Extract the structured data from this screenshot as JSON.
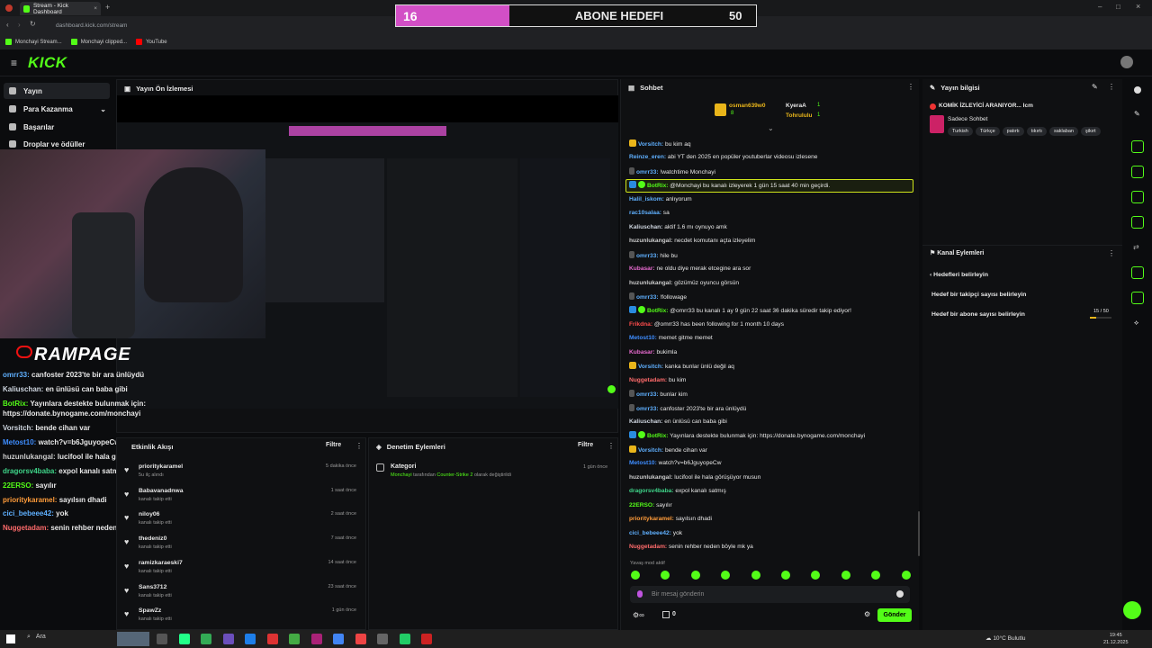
{
  "browser": {
    "tab_title": "Stream - Kick Dashboard",
    "url": "dashboard.kick.com/stream",
    "bookmarks": [
      "Monchayi Stream...",
      "Monchayi clipped...",
      "YouTube"
    ]
  },
  "goal": {
    "current": "16",
    "label": "ABONE HEDEFI",
    "target": "50"
  },
  "sidebar": {
    "items": [
      {
        "label": "Yayın"
      },
      {
        "label": "Para Kazanma"
      },
      {
        "label": "Başarılar"
      },
      {
        "label": "Droplar ve ödüller"
      }
    ]
  },
  "preview": {
    "title": "Yayın Ön İzlemesi",
    "overlay_brand": "RAMPAGE",
    "overlay_chat": [
      {
        "user": "omrr33:",
        "text": "canfoster 2023'te bir ara ünlüydü",
        "color": "#5fb0ff"
      },
      {
        "user": "Kaliuschan:",
        "text": "en ünlüsü can baba gibi",
        "color": "#cfd6e0"
      },
      {
        "user": "BotRix:",
        "text": "Yayınlara destekte bulunmak için:",
        "color": "#53fc18"
      },
      {
        "user": "",
        "text": "https://donate.bynogame.com/monchayi",
        "color": "#fff"
      },
      {
        "user": "Vorsitch:",
        "text": "bende cihan var",
        "color": "#cfd6e0"
      },
      {
        "user": "Metost10:",
        "text": "watch?v=b6JguyopeCw",
        "color": "#3e8dff"
      },
      {
        "user": "huzunlukangal:",
        "text": "lucifool ile hala görüşüyor musun",
        "color": "#ccc"
      },
      {
        "user": "dragorsv4baba:",
        "text": "expol kanalı satmış",
        "color": "#3fd68a"
      },
      {
        "user": "22ERSO:",
        "text": "sayılır",
        "color": "#53fc18"
      },
      {
        "user": "prioritykaramel:",
        "text": "sayılsın dhadi",
        "color": "#ff9c3a"
      },
      {
        "user": "cici_bebeee42:",
        "text": "yok",
        "color": "#5fb0ff"
      },
      {
        "user": "Nuggetadam:",
        "text": "senin rehber neden böyle mk ya",
        "color": "#ff6b6b"
      }
    ]
  },
  "activity": {
    "title": "Etkinlik Akışı",
    "filter": "Filtre",
    "rows": [
      {
        "name": "prioritykaramel",
        "sub": "5u ilç alındı",
        "time": "5 dakika önce"
      },
      {
        "name": "Babavanadnwa",
        "sub": "kanalı takip etti",
        "time": "1 saat önce"
      },
      {
        "name": "niloy06",
        "sub": "kanalı takip etti",
        "time": "2 saat önce"
      },
      {
        "name": "thedeniz0",
        "sub": "kanalı takip etti",
        "time": "7 saat önce"
      },
      {
        "name": "ramizkaraeski7",
        "sub": "kanalı takip etti",
        "time": "14 saat önce"
      },
      {
        "name": "Sans3712",
        "sub": "kanalı takip etti",
        "time": "23 saat önce"
      },
      {
        "name": "SpawZz",
        "sub": "kanalı takip etti",
        "time": "1 gün önce"
      }
    ]
  },
  "moderation": {
    "title": "Denetim Eylemleri",
    "filter": "Filtre",
    "row": {
      "title": "Kategori",
      "user": "Monchayi",
      "mid": "tarafından",
      "game": "Counter-Strike 2",
      "end": "olarak değiştirildi",
      "time": "1 gün önce"
    }
  },
  "chat": {
    "title": "Sohbet",
    "pinned": [
      {
        "name": "osman639w0",
        "count": "8"
      },
      {
        "name": "KyeraA",
        "count": "1"
      },
      {
        "name": "Tohrululu",
        "count": "1"
      }
    ],
    "messages": [
      {
        "user": "Vorsitch:",
        "text": "bu kim aq",
        "color": "#5fb0ff"
      },
      {
        "user": "Reinze_eren:",
        "text": "abi YT den 2025 en popüler youtuberlar videosu izlesene",
        "color": "#5fb0ff"
      },
      {
        "user": "omrr33:",
        "text": "!watchtime Monchayi",
        "color": "#5fb0ff"
      },
      {
        "user": "BotRix:",
        "text": "@Monchayi bu kanalı izleyerek 1 gün 15 saat 40 min geçirdi.",
        "color": "#53fc18"
      },
      {
        "user": "Halil_iskom:",
        "text": "anlıyorum",
        "color": "#5fb0ff"
      },
      {
        "user": "rac10salaa:",
        "text": "sa",
        "color": "#5fb0ff"
      },
      {
        "user": "Kaliuschan:",
        "text": "aktif 1.6 mı oynuyo amk",
        "color": "#cfd6e0"
      },
      {
        "user": "huzunlukangal:",
        "text": "necdet komutanı açta izleyelim",
        "color": "#ccc"
      },
      {
        "user": "omrr33:",
        "text": "hile bu",
        "color": "#5fb0ff"
      },
      {
        "user": "Kubasar:",
        "text": "ne oldu diye merak etcegine ara sor",
        "color": "#e86bd0"
      },
      {
        "user": "huzunlukangal:",
        "text": "gözümüz oyuncu görsün",
        "color": "#ccc"
      },
      {
        "user": "omrr33:",
        "text": "!followage",
        "color": "#5fb0ff"
      },
      {
        "user": "BotRix:",
        "text": "@omrr33 bu kanalı 1 ay 9 gün 22 saat 36 dakika süredir takip ediyor!",
        "color": "#53fc18"
      },
      {
        "user": "Frikdna:",
        "text": "@omrr33 has been following for 1 month 10 days",
        "color": "#ff4c4c"
      },
      {
        "user": "Metost10:",
        "text": "memet gitme memet",
        "color": "#3e8dff"
      },
      {
        "user": "Kubasar:",
        "text": "bukimla",
        "color": "#e86bd0"
      },
      {
        "user": "Vorsitch:",
        "text": "kanka bunlar ünlü değil aq",
        "color": "#5fb0ff"
      },
      {
        "user": "Nuggetadam:",
        "text": "bu kim",
        "color": "#ff6b6b"
      },
      {
        "user": "omrr33:",
        "text": "bunlar kim",
        "color": "#5fb0ff"
      },
      {
        "user": "omrr33:",
        "text": "canfoster 2023'te bir ara ünlüydü",
        "color": "#5fb0ff"
      },
      {
        "user": "Kaliuschan:",
        "text": "en ünlüsü can baba gibi",
        "color": "#cfd6e0"
      },
      {
        "user": "BotRix:",
        "text": "Yayınlara destekte bulunmak için: https://donate.bynogame.com/monchayi",
        "color": "#53fc18"
      },
      {
        "user": "Vorsitch:",
        "text": "bende cihan var",
        "color": "#5fb0ff"
      },
      {
        "user": "Metost10:",
        "text": "watch?v=b6JguyopeCw",
        "color": "#3e8dff"
      },
      {
        "user": "huzunlukangal:",
        "text": "lucifool ile hala görüşüyor musun",
        "color": "#ccc"
      },
      {
        "user": "dragorsv4baba:",
        "text": "expol kanalı satmış",
        "color": "#3fd68a"
      },
      {
        "user": "22ERSO:",
        "text": "sayılır",
        "color": "#53fc18"
      },
      {
        "user": "prioritykaramel:",
        "text": "sayılsın dhadi",
        "color": "#ff9c3a"
      },
      {
        "user": "cici_bebeee42:",
        "text": "yok",
        "color": "#5fb0ff"
      },
      {
        "user": "Nuggetadam:",
        "text": "senin rehber neden böyle mk ya",
        "color": "#ff6b6b"
      }
    ],
    "slow_mode": "Yavaş mod aktif",
    "placeholder": "Bir mesaj gönderin",
    "send": "Gönder",
    "count": "0"
  },
  "stream_info": {
    "title": "Yayın bilgisi",
    "stream_title": "KOMİK İZLEYİCİ ARANIYOR...",
    "stream_title_end": "Icm",
    "category": "Sadece Sohbet",
    "tags": [
      "Turkish",
      "Türkçe",
      "patırtı",
      "tıkırtı",
      "saklaban",
      "şikırt"
    ]
  },
  "channel_actions": {
    "title": "Kanal Eylemleri",
    "back": "Hedefleri belirleyin",
    "follow_goal": "Hedef bir takipçi sayısı belirleyin",
    "sub_goal": "Hedef bir abone sayısı belirleyin",
    "progress": "15 / 50",
    "progress_fraction": 0.3
  },
  "taskbar": {
    "search": "Ara",
    "weather": "10°C Bulutlu",
    "time": "19:45",
    "date": "21.12.2025"
  },
  "colors": {
    "accent": "#53fc18",
    "goal": "#d24fc6"
  }
}
